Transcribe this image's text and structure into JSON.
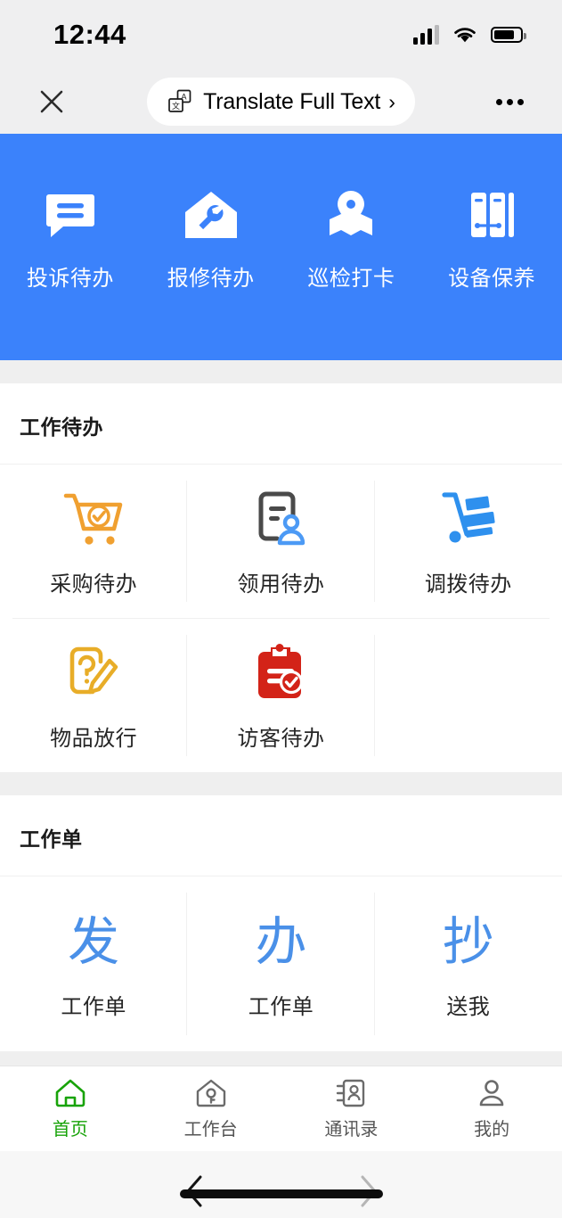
{
  "status_bar": {
    "time": "12:44",
    "signal_icon": "cellular-signal-icon",
    "wifi_icon": "wifi-icon",
    "battery_icon": "battery-icon"
  },
  "browser_chrome": {
    "close_label": "✕",
    "translate_icon": "translate-icon",
    "translate_label": "Translate Full Text",
    "translate_chevron": "›",
    "more_label": "more-options"
  },
  "banner": {
    "background_color": "#3B82FB",
    "items": [
      {
        "label": "投诉待办",
        "icon": "speech-bubble-icon"
      },
      {
        "label": "报修待办",
        "icon": "house-wrench-icon"
      },
      {
        "label": "巡检打卡",
        "icon": "map-pin-icon"
      },
      {
        "label": "设备保养",
        "icon": "binders-icon"
      }
    ]
  },
  "work_todo": {
    "title": "工作待办",
    "items": [
      {
        "label": "采购待办",
        "icon": "shopping-cart-check-icon",
        "color": "#F0A030"
      },
      {
        "label": "领用待办",
        "icon": "document-person-icon",
        "color": "#4A4A4A"
      },
      {
        "label": "调拨待办",
        "icon": "hand-truck-icon",
        "color": "#2E90EE"
      },
      {
        "label": "物品放行",
        "icon": "document-question-pencil-icon",
        "color": "#E8AD28"
      },
      {
        "label": "访客待办",
        "icon": "clipboard-check-icon",
        "color": "#D32318"
      }
    ]
  },
  "work_order": {
    "title": "工作单",
    "glyph_color": "#4A90E8",
    "items": [
      {
        "glyph": "发",
        "label": "工作单"
      },
      {
        "glyph": "办",
        "label": "工作单"
      },
      {
        "glyph": "抄",
        "label": "送我"
      }
    ]
  },
  "tabbar": {
    "active_color": "#18A309",
    "items": [
      {
        "label": "首页",
        "icon": "home-icon",
        "active": true
      },
      {
        "label": "工作台",
        "icon": "workbench-icon",
        "active": false
      },
      {
        "label": "通讯录",
        "icon": "contacts-icon",
        "active": false
      },
      {
        "label": "我的",
        "icon": "person-icon",
        "active": false
      }
    ]
  },
  "nav": {
    "back_icon": "chevron-left-icon",
    "forward_icon": "chevron-right-icon",
    "home_indicator": "home-indicator"
  }
}
